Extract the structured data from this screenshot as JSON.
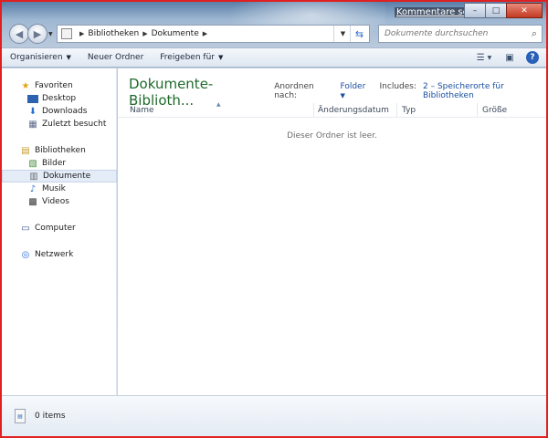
{
  "titlebar": {
    "feedback_link": "Kommentare senden",
    "minimize": "–",
    "maximize": "□",
    "close": "✕"
  },
  "address": {
    "crumbs": [
      "Bibliotheken",
      "Dokumente"
    ],
    "search_placeholder": "Dokumente durchsuchen"
  },
  "toolbar": {
    "organize": "Organisieren",
    "new_folder": "Neuer Ordner",
    "share": "Freigeben für"
  },
  "nav": {
    "favorites": "Favoriten",
    "desktop": "Desktop",
    "downloads": "Downloads",
    "recent": "Zuletzt besucht",
    "libraries": "Bibliotheken",
    "pictures": "Bilder",
    "documents": "Dokumente",
    "music": "Musik",
    "videos": "Videos",
    "computer": "Computer",
    "network": "Netzwerk"
  },
  "library": {
    "title": "Dokumente-Biblioth...",
    "arrange_label": "Anordnen nach:",
    "arrange_value": "Folder",
    "includes_label": "Includes:",
    "includes_value": "2 – Speicherorte für Bibliotheken"
  },
  "columns": {
    "name": "Name",
    "modified": "Änderungsdatum",
    "type": "Typ",
    "size": "Größe"
  },
  "empty_message": "Dieser Ordner ist leer.",
  "status": {
    "items": "0 items"
  }
}
